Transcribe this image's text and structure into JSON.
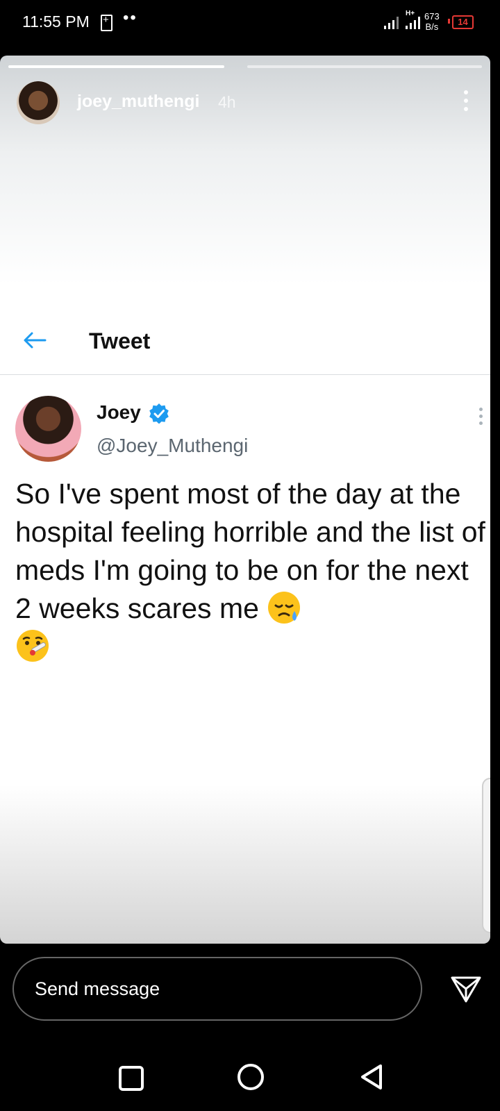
{
  "status_bar": {
    "time": "11:55 PM",
    "dots": "••",
    "network_type": "H+",
    "speed_value": "673",
    "speed_unit": "B/s",
    "battery_level": "14",
    "battery_color": "#e53935"
  },
  "story": {
    "progress": [
      1.0,
      0.0
    ],
    "username": "joey_muthengi",
    "time_ago": "4h",
    "menu_icon": "vertical-ellipsis-icon"
  },
  "tweet": {
    "header_title": "Tweet",
    "back_icon": "arrow-left-icon",
    "author_name": "Joey",
    "verified_icon": "verified-badge-icon",
    "handle": "@Joey_Muthengi",
    "body": "So I've spent most of the day at the hospital feeling horrible and the list of meds I'm going to be on for the next 2 weeks scares me",
    "emojis": [
      "sad-tear-face-emoji",
      "thermometer-face-emoji"
    ],
    "accent_color": "#1d9bf0"
  },
  "composer": {
    "placeholder": "Send message",
    "send_icon": "send-paper-plane-icon"
  },
  "nav_bar": {
    "items": [
      "recents-square-icon",
      "home-circle-icon",
      "back-triangle-icon"
    ]
  }
}
